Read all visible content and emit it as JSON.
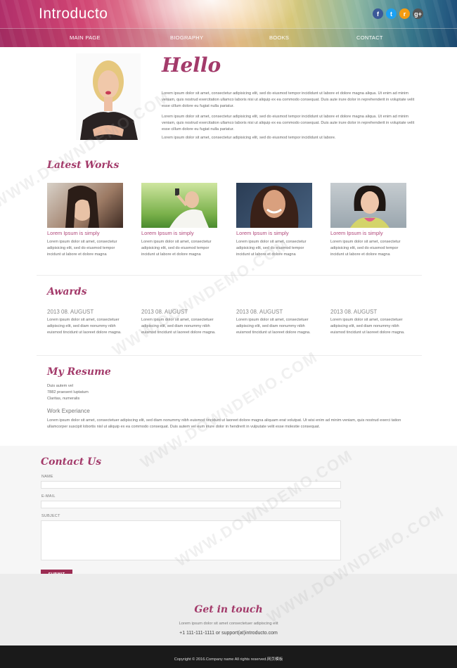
{
  "header": {
    "logo": "Introducto",
    "social": [
      {
        "name": "facebook-icon",
        "glyph": "f",
        "color": "#3b5998"
      },
      {
        "name": "twitter-icon",
        "glyph": "t",
        "color": "#1da1f2"
      },
      {
        "name": "rss-icon",
        "glyph": "r",
        "color": "#f39c12"
      },
      {
        "name": "google-plus-icon",
        "glyph": "g+",
        "color": "#555555"
      }
    ],
    "nav": [
      "MAIN PAGE",
      "BIOGRAPHY",
      "BOOKS",
      "CONTACT"
    ]
  },
  "hello": {
    "title": "Hello",
    "paragraphs": [
      "Lorem ipsum dolor sit amet, consectetur adipisicing elit, sed do eiusmod tempor incididunt ut labore et dolore magna aliqua. Ut enim ad minim veniam, quis nostrud exercitation ullamco laboris nisi ut aliquip ex ea commodo consequat. Duis aute irure dolor in reprehenderit in voluptate velit esse cillum dolore eu fugiat nulla pariatur.",
      "Lorem ipsum dolor sit amet, consectetur adipisicing elit, sed do eiusmod tempor incididunt ut labore et dolore magna aliqua. Ut enim ad minim veniam, quis nostrud exercitation ullamco laboris nisi ut aliquip ex ea commodo consequat. Duis aute irure dolor in reprehenderit in voluptate velit esse cillum dolore eu fugiat nulla pariatur.",
      "Lorem ipsum dolor sit amet, consectetur adipisicing elit, sed do eiusmod tempor incididunt ut labore."
    ]
  },
  "latest_works": {
    "title": "Latest Works",
    "items": [
      {
        "caption": "Lorem Ipsum is simply",
        "text": "Lorem ipsum dolor sit amet, consectetur adipisicing elit, sed do eiusmod tempor incidunt ut labore et dolore magna"
      },
      {
        "caption": "Lorem Ipsum is simply",
        "text": "Lorem ipsum dolor sit amet, consectetur adipisicing elit, sed do eiusmod tempor incidunt ut labore et dolore magna"
      },
      {
        "caption": "Lorem Ipsum is simply",
        "text": "Lorem ipsum dolor sit amet, consectetur adipisicing elit, sed do eiusmod tempor incidunt ut labore et dolore magna"
      },
      {
        "caption": "Lorem Ipsum is simply",
        "text": "Lorem ipsum dolor sit amet, consectetur adipisicing elit, sed do eiusmod tempor incidunt ut labore et dolore magna"
      }
    ]
  },
  "awards": {
    "title": "Awards",
    "items": [
      {
        "date": "2013 08. AUGUST",
        "text": "Lorem ipsum dolor sit amet, consectetuer adipiscing elit, sed diam nonummy nibh euismod tincidunt ut laoreet dolore magna."
      },
      {
        "date": "2013 08. AUGUST",
        "text": "Lorem ipsum dolor sit amet, consectetuer adipiscing elit, sed diam nonummy nibh euismod tincidunt ut laoreet dolore magna."
      },
      {
        "date": "2013 08. AUGUST",
        "text": "Lorem ipsum dolor sit amet, consectetuer adipiscing elit, sed diam nonummy nibh euismod tincidunt ut laoreet dolore magna."
      },
      {
        "date": "2013 08. AUGUST",
        "text": "Lorem ipsum dolor sit amet, consectetuer adipiscing elit, sed diam nonummy nibh euismod tincidunt ut laoreet dolore magna."
      }
    ]
  },
  "resume": {
    "title": "My Resume",
    "lines": [
      "Duis autem vel",
      "7882 praesent luptatum",
      "Claritas, numeralis"
    ],
    "subtitle": "Work Experiance",
    "text": "Lorem ipsum dolor sit amet, consectetuer adipiscing elit, sed diam nonummy nibh euismod tincidunt ut laoreet dolore magna aliquam erat volutpat. Ut wisi enim ad minim veniam, quis nostrud exerci tation ullamcorper suscipit lobortis nisl ut aliquip ex ea commodo consequat. Duis autem vel eum iriure dolor in hendrerit in vulputate velit esse molestie consequat."
  },
  "contact": {
    "title": "Contact Us",
    "name_label": "NAME",
    "email_label": "E-MAIL",
    "subject_label": "SUBJECT",
    "name_value": "",
    "email_value": "",
    "subject_value": "",
    "submit": "SUBMIT"
  },
  "footer": {
    "title": "Get in touch",
    "tagline": "Lorem ipsum dolor sit amet consectetuer adipiscing elit",
    "phone_line": "+1 111-111-1111 or support(at)introducto.com",
    "copyright": "Copyright © 2016.Company name All rights reserved.网页模板",
    "watermark": "WWW.DOWNDEMO.COM"
  }
}
